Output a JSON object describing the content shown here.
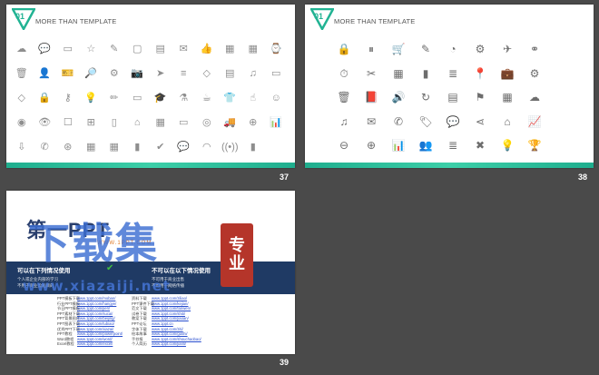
{
  "slides": [
    {
      "number": "37",
      "badge": "01",
      "title": "MORE THAN TEMPLATE",
      "icons": [
        "☁",
        "💬",
        "▭",
        "☆",
        "✎",
        "▢",
        "▤",
        "✉",
        "👍",
        "▦",
        "▦",
        "⌚",
        "🗑",
        "👤",
        "🎫",
        "🔎",
        "⚙",
        "📷",
        "➤",
        "≡",
        "◇",
        "▤",
        "♫",
        "▭",
        "◇",
        "🔒",
        "⚷",
        "💡",
        "✏",
        "▭",
        "🎓",
        "⚗",
        "☕",
        "👕",
        "☝",
        "☺",
        "◉",
        "👁",
        "☐",
        "⊞",
        "▯",
        "⌂",
        "▦",
        "▭",
        "◎",
        "🚚",
        "⊕",
        "📊",
        "⇩",
        "✆",
        "⊛",
        "▦",
        "▦",
        "▮",
        "✔",
        "💬",
        "◠",
        "((•))",
        "▮"
      ]
    },
    {
      "number": "38",
      "badge": "01",
      "title": "MORE THAN TEMPLATE",
      "icons": [
        "🔒",
        "⏸",
        "🛒",
        "✎",
        "◔",
        "⚙",
        "✈",
        "⚭",
        "",
        "⏱",
        "✂",
        "▦",
        "▮",
        "≣",
        "📍",
        "💼",
        "⚙",
        "",
        "🗑",
        "📕",
        "🔊",
        "↻",
        "▤",
        "⚑",
        "▦",
        "☁",
        "",
        "♫",
        "✉",
        "✆",
        "🏷",
        "💬",
        "⋖",
        "⌂",
        "📈",
        "",
        "⊖",
        "⊕",
        "📊",
        "👥",
        "≣",
        "✖",
        "💡",
        "🏆",
        ""
      ]
    },
    {
      "number": "39",
      "logo": "第一PPT",
      "subtitle": "WWW.1PPT.COM",
      "left_heading": "可以在下列情况使用",
      "left_lines": [
        "个人或企业内部的学习",
        "不用于商业盈利目的"
      ],
      "right_heading": "不可以在以下情况使用",
      "right_lines": [
        "不可用于商业出售",
        "不可用于网络传播"
      ],
      "watermark_main": "下载集",
      "watermark_stamp": [
        "专",
        "业"
      ],
      "watermark_url": "www.xiazaiji.net",
      "links_left": [
        {
          "k": "PPT模板下载",
          "v": "www.1ppt.com/moban/"
        },
        {
          "k": "行业PPT模板",
          "v": "www.1ppt.com/hangye/"
        },
        {
          "k": "节日PPT模板",
          "v": "www.1ppt.com/jieri/"
        },
        {
          "k": "PPT素材下载",
          "v": "www.1ppt.com/sucai/"
        },
        {
          "k": "PPT背景图片",
          "v": "www.1ppt.com/beijing/"
        },
        {
          "k": "PPT图表下载",
          "v": "www.1ppt.com/tubiao/"
        },
        {
          "k": "优秀PPT下载",
          "v": "www.1ppt.com/xiazai/"
        },
        {
          "k": "PPT教程",
          "v": "www.1ppt.com/powerpoint/"
        },
        {
          "k": "Word教程",
          "v": "www.1ppt.com/word/"
        },
        {
          "k": "Excel教程",
          "v": "www.1ppt.com/excel/"
        }
      ],
      "links_right": [
        {
          "k": "资料下载",
          "v": "www.1ppt.com/ziliao/"
        },
        {
          "k": "PPT课件下载",
          "v": "www.1ppt.com/kejian/"
        },
        {
          "k": "范文下载",
          "v": "www.1ppt.com/fanwen/"
        },
        {
          "k": "试卷下载",
          "v": "www.1ppt.com/shiti/"
        },
        {
          "k": "教案下载",
          "v": "www.1ppt.com/jiaoan/"
        },
        {
          "k": "PPT论坛",
          "v": "www.1ppt.cn"
        },
        {
          "k": "字体下载",
          "v": "www.1ppt.com/ziti/"
        },
        {
          "k": "绘本故事",
          "v": "www.1ppt.com/gushi/"
        },
        {
          "k": "手抄报",
          "v": "www.1ppt.com/shouchaobao/"
        },
        {
          "k": "个人简历",
          "v": "www.1ppt.com/jianli/"
        }
      ]
    }
  ],
  "colors": {
    "background": "#4a4a4a",
    "accent": "#21b393",
    "band": "#1f3a64"
  }
}
